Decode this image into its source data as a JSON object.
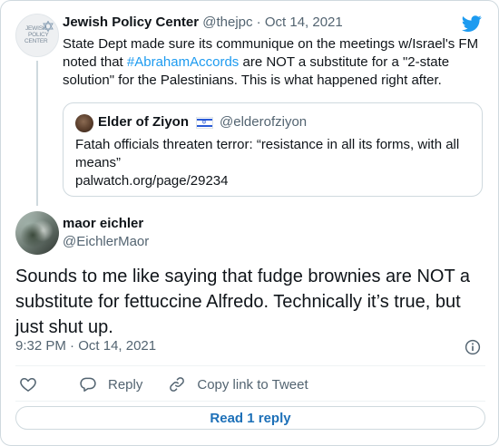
{
  "parent": {
    "author_name": "Jewish Policy Center",
    "handle": "@thejpc",
    "separator": "·",
    "date": "Oct 14, 2021",
    "avatar_words": [
      "JEWISH",
      "POLICY",
      "CENTER"
    ],
    "text_before": "State Dept made sure its communique on the meetings w/Israel's FM noted that ",
    "hashtag": "#AbrahamAccords",
    "text_after": " are NOT a substitute for a \"2-state solution\" for the Palestinians. This is what happened right after."
  },
  "quote": {
    "author_name": "Elder of Ziyon",
    "handle": "@elderofziyon",
    "text": "Fatah officials threaten terror: “resistance in all its forms, with all means”",
    "link": "palwatch.org/page/29234"
  },
  "reply": {
    "author_name": "maor eichler",
    "handle": "@EichlerMaor",
    "text": "Sounds to me like saying that fudge brownies are NOT a substitute for fettuccine Alfredo. Technically it’s true, but just shut up.",
    "time": "9:32 PM",
    "separator": "·",
    "date": "Oct 14, 2021"
  },
  "actions": {
    "reply_label": "Reply",
    "copy_link_label": "Copy link to Tweet"
  },
  "read_replies_label": "Read 1 reply",
  "colors": {
    "accent": "#1d9bf0",
    "muted": "#536471",
    "border": "#cfd9de",
    "button_text": "#1d70b8"
  },
  "icons": [
    "twitter-bird-icon",
    "info-icon",
    "heart-icon",
    "reply-icon",
    "link-icon",
    "israel-flag-icon"
  ]
}
